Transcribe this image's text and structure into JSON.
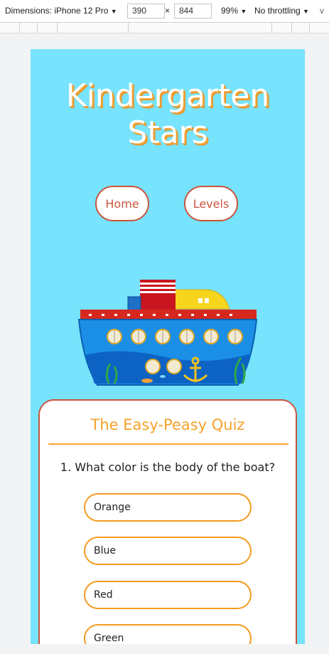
{
  "devtools": {
    "dimensions_label": "Dimensions: iPhone 12 Pro",
    "width_value": "390",
    "times_sign": "×",
    "height_value": "844",
    "zoom": "99%",
    "throttling": "No throttling",
    "cut_label": "v"
  },
  "site": {
    "title_line1": "Kindergarten",
    "title_line2": "Stars",
    "nav": [
      {
        "label": "Home"
      },
      {
        "label": "Levels"
      }
    ]
  },
  "quiz": {
    "title": "The Easy-Peasy Quiz",
    "question": "1. What color is the body of the boat?",
    "answers": [
      "Orange",
      "Blue",
      "Red",
      "Green"
    ]
  },
  "colors": {
    "sky": "#77e3fc",
    "accent_orange": "#f4a22b",
    "accent_red": "#c9543d"
  }
}
